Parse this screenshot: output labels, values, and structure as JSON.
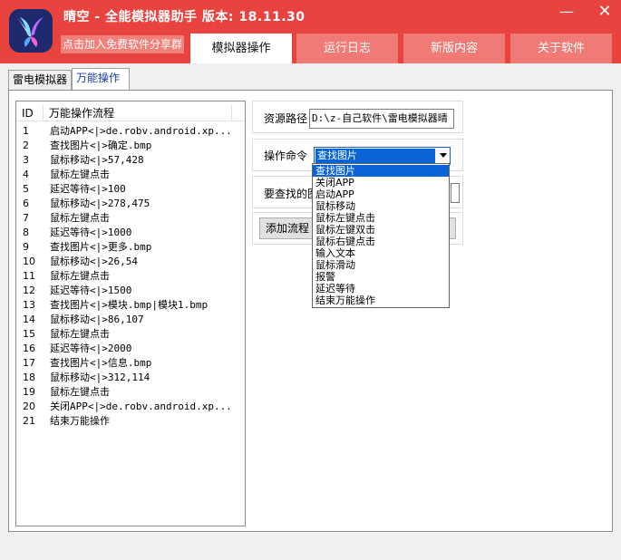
{
  "app": {
    "title": "晴空 - 全能模拟器助手  版本: 18.11.30",
    "promo": "点击加入免费软件分享群"
  },
  "window_controls": {
    "minimize": "—",
    "close": "✕"
  },
  "main_tabs": [
    {
      "label": "模拟器操作",
      "active": true
    },
    {
      "label": "运行日志",
      "active": false
    },
    {
      "label": "新版内容",
      "active": false
    },
    {
      "label": "关于软件",
      "active": false
    }
  ],
  "sub_tabs": [
    {
      "label": "雷电模拟器",
      "active": false
    },
    {
      "label": "万能操作",
      "active": true
    }
  ],
  "list": {
    "headers": [
      "ID",
      "万能操作流程"
    ],
    "rows": [
      {
        "id": "1",
        "op": "启动APP<|>de.robv.android.xp..."
      },
      {
        "id": "2",
        "op": "查找图片<|>确定.bmp"
      },
      {
        "id": "3",
        "op": "鼠标移动<|>57,428"
      },
      {
        "id": "4",
        "op": "鼠标左键点击"
      },
      {
        "id": "5",
        "op": "延迟等待<|>100"
      },
      {
        "id": "6",
        "op": "鼠标移动<|>278,475"
      },
      {
        "id": "7",
        "op": "鼠标左键点击"
      },
      {
        "id": "8",
        "op": "延迟等待<|>1000"
      },
      {
        "id": "9",
        "op": "查找图片<|>更多.bmp"
      },
      {
        "id": "10",
        "op": "鼠标移动<|>26,54"
      },
      {
        "id": "11",
        "op": "鼠标左键点击"
      },
      {
        "id": "12",
        "op": "延迟等待<|>1500"
      },
      {
        "id": "13",
        "op": "查找图片<|>模块.bmp|模块1.bmp"
      },
      {
        "id": "14",
        "op": "鼠标移动<|>86,107"
      },
      {
        "id": "15",
        "op": "鼠标左键点击"
      },
      {
        "id": "16",
        "op": "延迟等待<|>2000"
      },
      {
        "id": "17",
        "op": "查找图片<|>信息.bmp"
      },
      {
        "id": "18",
        "op": "鼠标移动<|>312,114"
      },
      {
        "id": "19",
        "op": "鼠标左键点击"
      },
      {
        "id": "20",
        "op": "关闭APP<|>de.robv.android.xp..."
      },
      {
        "id": "21",
        "op": "结束万能操作"
      }
    ]
  },
  "form": {
    "resource_path_label": "资源路径",
    "resource_path_value": "D:\\z-自己软件\\雷电模拟器晴",
    "command_label": "操作命令",
    "command_value": "查找图片",
    "find_image_label": "要查找的图",
    "add_button": "添加流程"
  },
  "dropdown": {
    "options": [
      "查找图片",
      "关闭APP",
      "启动APP",
      "鼠标移动",
      "鼠标左键点击",
      "鼠标左键双击",
      "鼠标右键点击",
      "输入文本",
      "鼠标滑动",
      "报警",
      "延迟等待",
      "结束万能操作"
    ],
    "selected_index": 0
  },
  "colors": {
    "titlebar": "#e8433f",
    "tab_inactive": "#f07b76",
    "selection": "#0a64d6"
  }
}
